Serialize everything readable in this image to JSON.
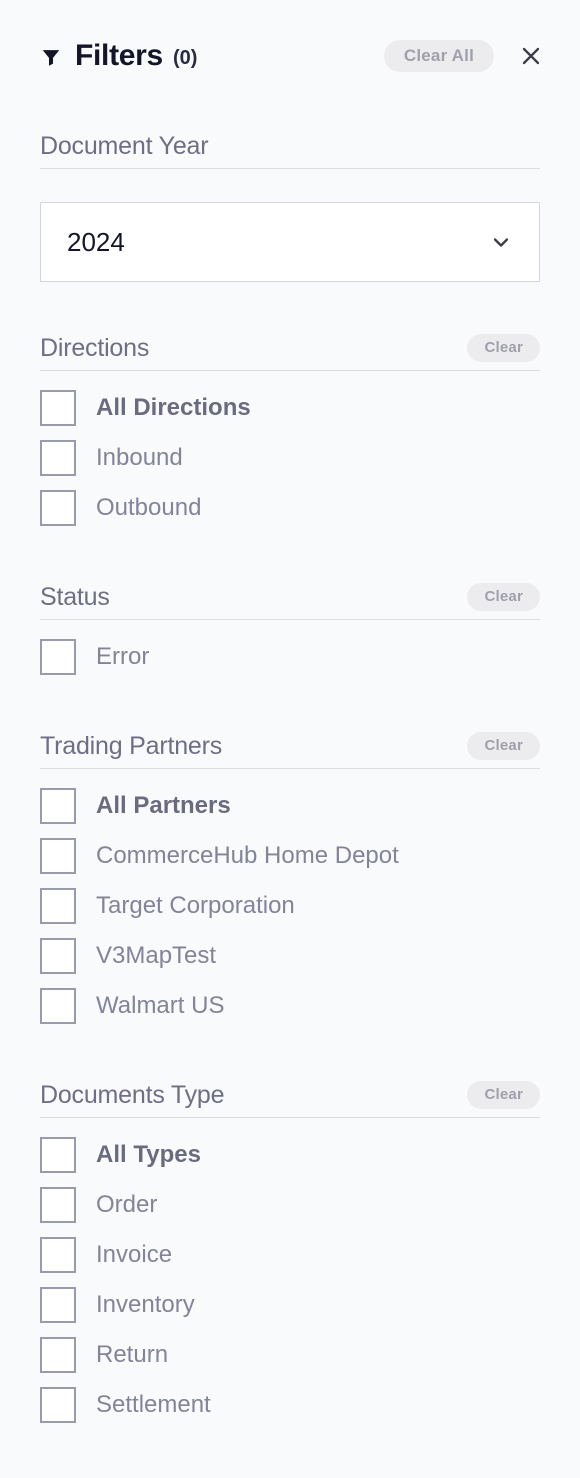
{
  "header": {
    "icon": "funnel-icon",
    "title": "Filters",
    "count": "(0)",
    "clear_all_label": "Clear All",
    "close_icon": "close-icon"
  },
  "colors": {
    "background": "#f9fafc",
    "title_text": "#14142b",
    "section_title": "#6e6e86",
    "option_text": "#83839a",
    "option_all_text": "#6b6b80",
    "pill_bg": "#ececef",
    "pill_text": "#a0a0ad",
    "divider": "#dcdce3",
    "checkbox_border": "#9a9aad",
    "select_border": "#d5d5dd",
    "select_bg": "#ffffff"
  },
  "sections": {
    "document_year": {
      "title": "Document Year",
      "select": {
        "value": "2024",
        "icon": "chevron-down-icon"
      }
    },
    "directions": {
      "title": "Directions",
      "clear_label": "Clear",
      "options": [
        {
          "label": "All Directions",
          "checked": false,
          "is_all": true
        },
        {
          "label": "Inbound",
          "checked": false,
          "is_all": false
        },
        {
          "label": "Outbound",
          "checked": false,
          "is_all": false
        }
      ]
    },
    "status": {
      "title": "Status",
      "clear_label": "Clear",
      "options": [
        {
          "label": "Error",
          "checked": false,
          "is_all": false
        }
      ]
    },
    "trading_partners": {
      "title": "Trading Partners",
      "clear_label": "Clear",
      "options": [
        {
          "label": "All Partners",
          "checked": false,
          "is_all": true
        },
        {
          "label": "CommerceHub Home Depot",
          "checked": false,
          "is_all": false
        },
        {
          "label": "Target Corporation",
          "checked": false,
          "is_all": false
        },
        {
          "label": "V3MapTest",
          "checked": false,
          "is_all": false
        },
        {
          "label": "Walmart US",
          "checked": false,
          "is_all": false
        }
      ]
    },
    "documents_type": {
      "title": "Documents Type",
      "clear_label": "Clear",
      "options": [
        {
          "label": "All Types",
          "checked": false,
          "is_all": true
        },
        {
          "label": "Order",
          "checked": false,
          "is_all": false
        },
        {
          "label": "Invoice",
          "checked": false,
          "is_all": false
        },
        {
          "label": "Inventory",
          "checked": false,
          "is_all": false
        },
        {
          "label": "Return",
          "checked": false,
          "is_all": false
        },
        {
          "label": "Settlement",
          "checked": false,
          "is_all": false
        }
      ]
    }
  }
}
